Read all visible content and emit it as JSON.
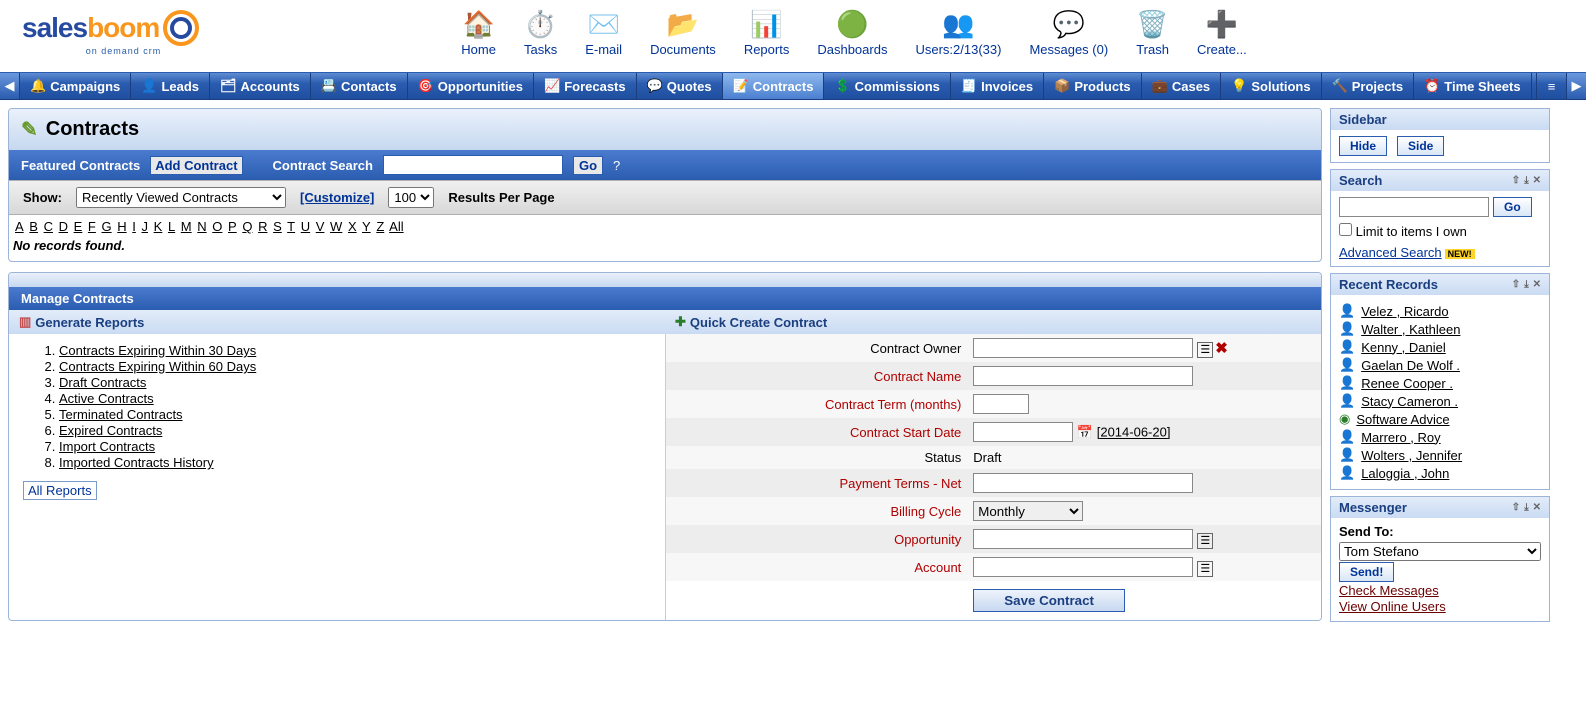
{
  "logo": {
    "text1": "sales",
    "text2": "boom",
    "sub": "on demand crm"
  },
  "topnav": [
    {
      "label": "Home",
      "emoji": "🏠"
    },
    {
      "label": "Tasks",
      "emoji": "⏱️"
    },
    {
      "label": "E-mail",
      "emoji": "✉️"
    },
    {
      "label": "Documents",
      "emoji": "📂"
    },
    {
      "label": "Reports",
      "emoji": "📊"
    },
    {
      "label": "Dashboards",
      "emoji": "🟢"
    },
    {
      "label": "Users:2/13(33)",
      "emoji": "👥"
    },
    {
      "label": "Messages (0)",
      "emoji": "💬"
    },
    {
      "label": "Trash",
      "emoji": "🗑️"
    },
    {
      "label": "Create...",
      "emoji": "➕"
    }
  ],
  "tabs": [
    "Campaigns",
    "Leads",
    "Accounts",
    "Contacts",
    "Opportunities",
    "Forecasts",
    "Quotes",
    "Contracts",
    "Commissions",
    "Invoices",
    "Products",
    "Cases",
    "Solutions",
    "Projects",
    "Time Sheets"
  ],
  "activeTab": "Contracts",
  "pageTitle": "Contracts",
  "featured": {
    "label": "Featured Contracts",
    "add": "Add Contract",
    "searchLbl": "Contract Search",
    "go": "Go"
  },
  "filter": {
    "show": "Show:",
    "selected": "Recently Viewed Contracts",
    "customize": "[Customize]",
    "perpage": "100",
    "perpageLbl": "Results Per Page"
  },
  "az": [
    "A",
    "B",
    "C",
    "D",
    "E",
    "F",
    "G",
    "H",
    "I",
    "J",
    "K",
    "L",
    "M",
    "N",
    "O",
    "P",
    "Q",
    "R",
    "S",
    "T",
    "U",
    "V",
    "W",
    "X",
    "Y",
    "Z",
    "All"
  ],
  "noRecords": "No records found.",
  "manageTitle": "Manage Contracts",
  "genReports": "Generate Reports",
  "reports": [
    "Contracts Expiring Within 30 Days",
    "Contracts Expiring Within 60 Days",
    "Draft Contracts",
    "Active Contracts",
    "Terminated Contracts",
    "Expired Contracts",
    "Import Contracts",
    "Imported Contracts History"
  ],
  "allReports": "All Reports",
  "quickCreate": "Quick Create Contract",
  "form": {
    "owner": "Contract Owner",
    "name": "Contract Name",
    "term": "Contract Term (months)",
    "start": "Contract Start Date",
    "startHint": "[2014-06-20]",
    "status": "Status",
    "statusVal": "Draft",
    "pay": "Payment Terms - Net",
    "billing": "Billing Cycle",
    "billingVal": "Monthly",
    "opp": "Opportunity",
    "acct": "Account",
    "save": "Save Contract"
  },
  "sidebar": {
    "title": "Sidebar",
    "hide": "Hide",
    "side": "Side",
    "search": "Search",
    "go": "Go",
    "limit": "Limit to items I own",
    "adv": "Advanced Search",
    "new": "NEW!",
    "recent": "Recent Records",
    "records": [
      {
        "t": "p",
        "n": "Velez , Ricardo"
      },
      {
        "t": "p",
        "n": "Walter , Kathleen"
      },
      {
        "t": "p",
        "n": "Kenny , Daniel"
      },
      {
        "t": "p",
        "n": "Gaelan De Wolf ."
      },
      {
        "t": "p",
        "n": "Renee Cooper ."
      },
      {
        "t": "p",
        "n": "Stacy Cameron ."
      },
      {
        "t": "g",
        "n": "Software Advice"
      },
      {
        "t": "p",
        "n": "Marrero , Roy"
      },
      {
        "t": "p",
        "n": "Wolters , Jennifer"
      },
      {
        "t": "p",
        "n": "Laloggia , John"
      }
    ],
    "messenger": "Messenger",
    "sendTo": "Send To:",
    "sendToVal": "Tom Stefano",
    "send": "Send!",
    "check": "Check Messages",
    "online": "View Online Users"
  }
}
